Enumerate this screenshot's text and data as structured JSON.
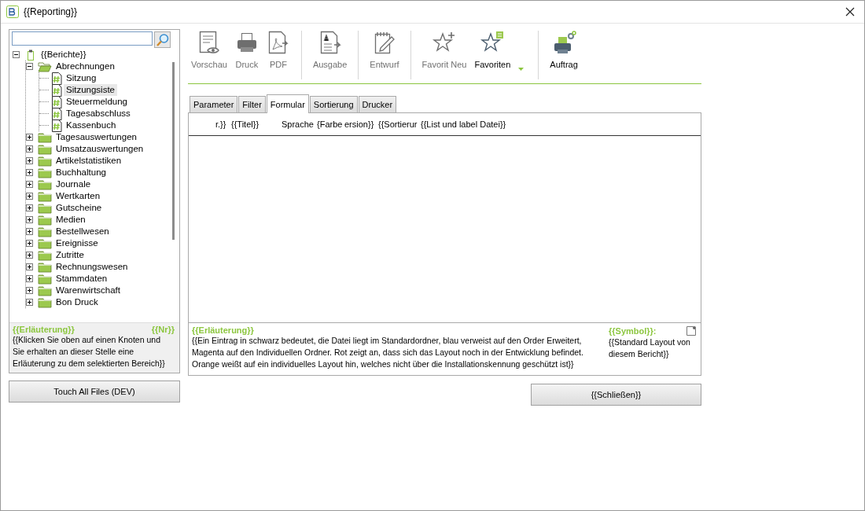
{
  "window": {
    "title": "{{Reporting}}"
  },
  "tree": [
    {
      "label": "{{Berichte}}",
      "kind": "root",
      "expanded": true,
      "selected": false,
      "children": [
        {
          "label": "Abrechnungen",
          "kind": "folder",
          "expanded": true,
          "selected": false,
          "children": [
            {
              "label": "Sitzung",
              "kind": "report",
              "selected": false
            },
            {
              "label": "Sitzungsiste",
              "kind": "report",
              "selected": true
            },
            {
              "label": "Steuermeldung",
              "kind": "report",
              "selected": false
            },
            {
              "label": "Tagesabschluss",
              "kind": "report",
              "selected": false
            },
            {
              "label": "Kassenbuch",
              "kind": "report",
              "selected": false
            }
          ]
        },
        {
          "label": "Tagesauswertungen",
          "kind": "folder",
          "expanded": false,
          "selected": false
        },
        {
          "label": "Umsatzauswertungen",
          "kind": "folder",
          "expanded": false,
          "selected": false
        },
        {
          "label": "Artikelstatistiken",
          "kind": "folder",
          "expanded": false,
          "selected": false
        },
        {
          "label": "Buchhaltung",
          "kind": "folder",
          "expanded": false,
          "selected": false
        },
        {
          "label": "Journale",
          "kind": "folder",
          "expanded": false,
          "selected": false
        },
        {
          "label": "Wertkarten",
          "kind": "folder",
          "expanded": false,
          "selected": false
        },
        {
          "label": "Gutscheine",
          "kind": "folder",
          "expanded": false,
          "selected": false
        },
        {
          "label": "Medien",
          "kind": "folder",
          "expanded": false,
          "selected": false
        },
        {
          "label": "Bestellwesen",
          "kind": "folder",
          "expanded": false,
          "selected": false
        },
        {
          "label": "Ereignisse",
          "kind": "folder",
          "expanded": false,
          "selected": false
        },
        {
          "label": "Zutritte",
          "kind": "folder",
          "expanded": false,
          "selected": false
        },
        {
          "label": "Rechnungswesen",
          "kind": "folder",
          "expanded": false,
          "selected": false
        },
        {
          "label": "Stammdaten",
          "kind": "folder",
          "expanded": false,
          "selected": false
        },
        {
          "label": "Warenwirtschaft",
          "kind": "folder",
          "expanded": false,
          "selected": false
        },
        {
          "label": "Bon Druck",
          "kind": "folder",
          "expanded": false,
          "selected": false
        }
      ]
    }
  ],
  "left_info": {
    "title": "{{Erläuterung}}",
    "number": "{{Nr}}",
    "text": "{{Klicken Sie oben auf einen Knoten und Sie erhalten an dieser Stelle eine Erläuterung zu dem selektierten Bereich}}"
  },
  "left_button": "Touch All Files (DEV)",
  "toolbar": [
    [
      {
        "label": "Vorschau",
        "kind": "preview",
        "disabled": true
      },
      {
        "label": "Druck",
        "kind": "print",
        "disabled": true
      },
      {
        "label": "PDF",
        "kind": "pdf",
        "disabled": true
      }
    ],
    [
      {
        "label": "Ausgabe",
        "kind": "export",
        "disabled": true
      }
    ],
    [
      {
        "label": "Entwurf",
        "kind": "design",
        "disabled": true
      }
    ],
    [
      {
        "label": "Favorit Neu",
        "kind": "star_add",
        "disabled": true
      },
      {
        "label": "Favoriten",
        "kind": "star_list",
        "disabled": false,
        "dropdown": true
      }
    ],
    [
      {
        "label": "Auftrag",
        "kind": "job",
        "disabled": false
      }
    ]
  ],
  "tabs": [
    {
      "label": "Parameter",
      "selected": false
    },
    {
      "label": "Filter",
      "selected": false
    },
    {
      "label": "Formular",
      "selected": true
    },
    {
      "label": "Sortierung",
      "selected": false
    },
    {
      "label": "Drucker",
      "selected": false
    }
  ],
  "table": {
    "columns": [
      "r.}}",
      "{{Titel}}",
      "Sprache",
      "{Farbe",
      "ersion}}",
      "{{Sortierur",
      "{{List und label Datei}}"
    ]
  },
  "right_info": {
    "title": "{{Erläuterung}}",
    "text": "{{Ein Eintrag in schwarz bedeutet, die Datei liegt im Standardordner, blau verweist auf den Order Erweitert, Magenta auf den Individuellen Ordner. Rot zeigt an, dass sich das Layout noch in der Entwicklung befindet. Orange weißt auf ein individuelles Layout hin, welches nicht über die Installationskennung geschützt ist}}",
    "symbol_title": "{{Symbol}}:",
    "symbol_text": "{{Standard Layout von diesem Bericht}}"
  },
  "close_button": "{{Schließen}}"
}
